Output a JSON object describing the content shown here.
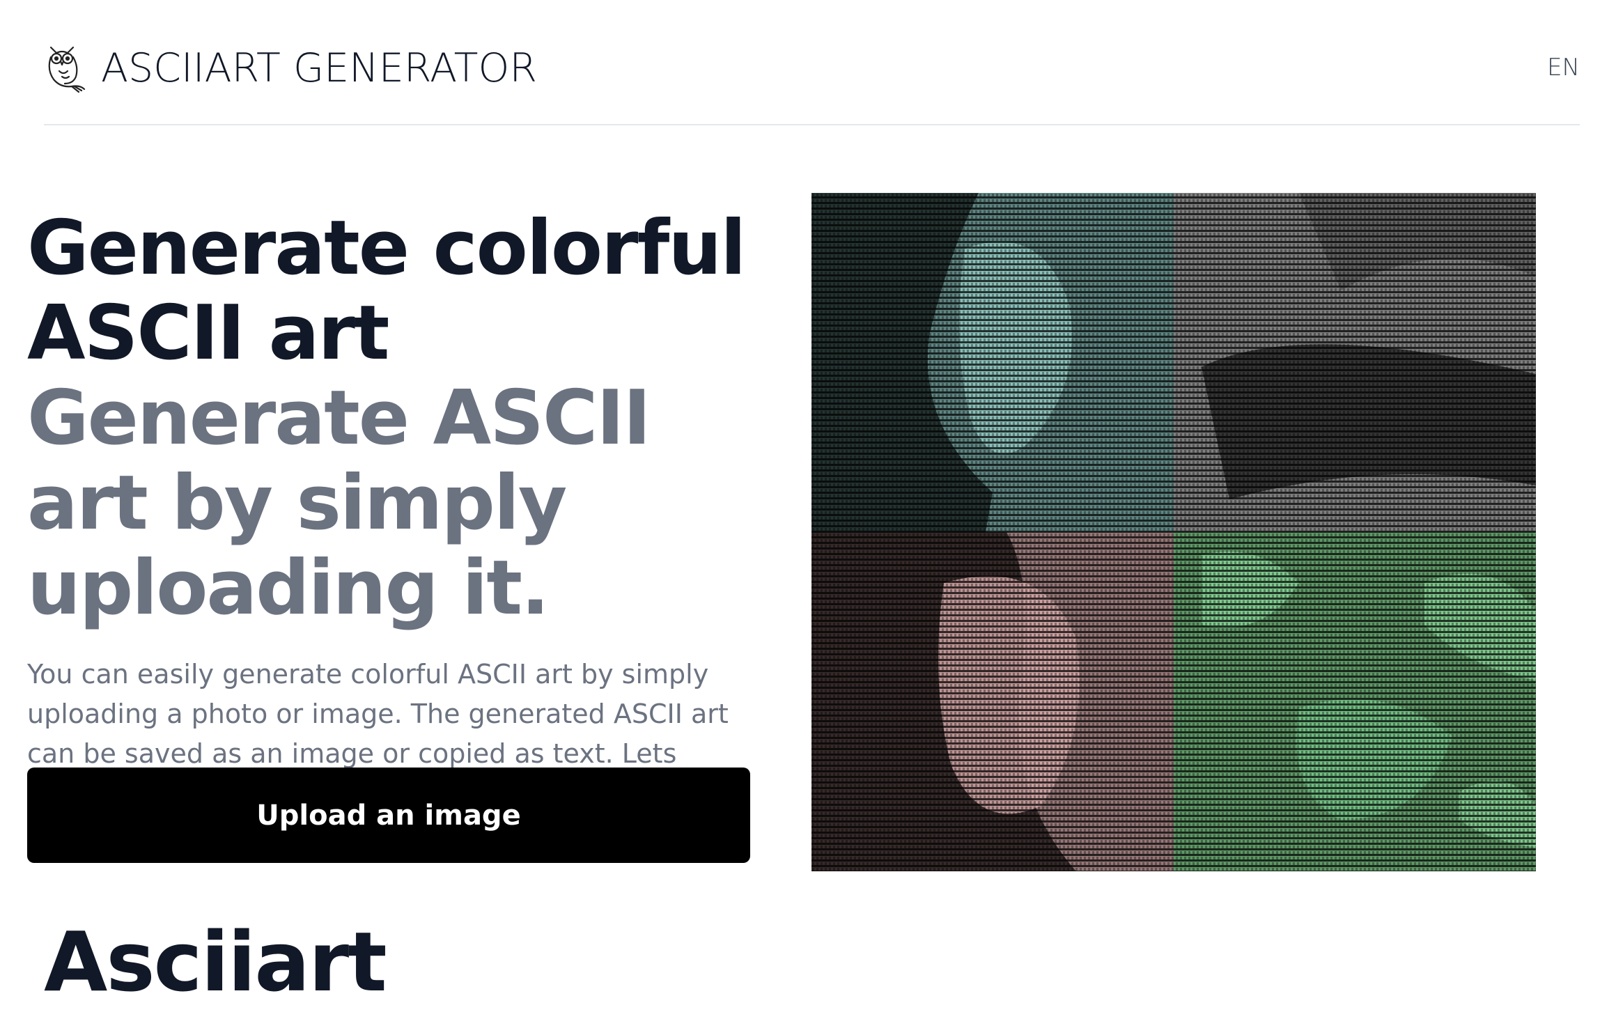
{
  "header": {
    "brand": "ASCIIART GENERATOR",
    "logo_icon": "owl-icon",
    "language": "EN"
  },
  "hero": {
    "headline_dark": "Generate colorful ASCII art",
    "headline_muted": "Generate ASCII art by simply uploading it.",
    "description": "You can easily generate colorful ASCII art by simply uploading a photo or image. The generated ASCII art can be saved as an image or copied as text. Lets generate lots of them!",
    "upload_label": "Upload an image"
  },
  "preview": {
    "quadrant_colors": [
      "#7fb3ad",
      "#a9a9a9",
      "#c9a0a0",
      "#7fcc8a"
    ]
  },
  "section": {
    "title": "Asciiart"
  }
}
